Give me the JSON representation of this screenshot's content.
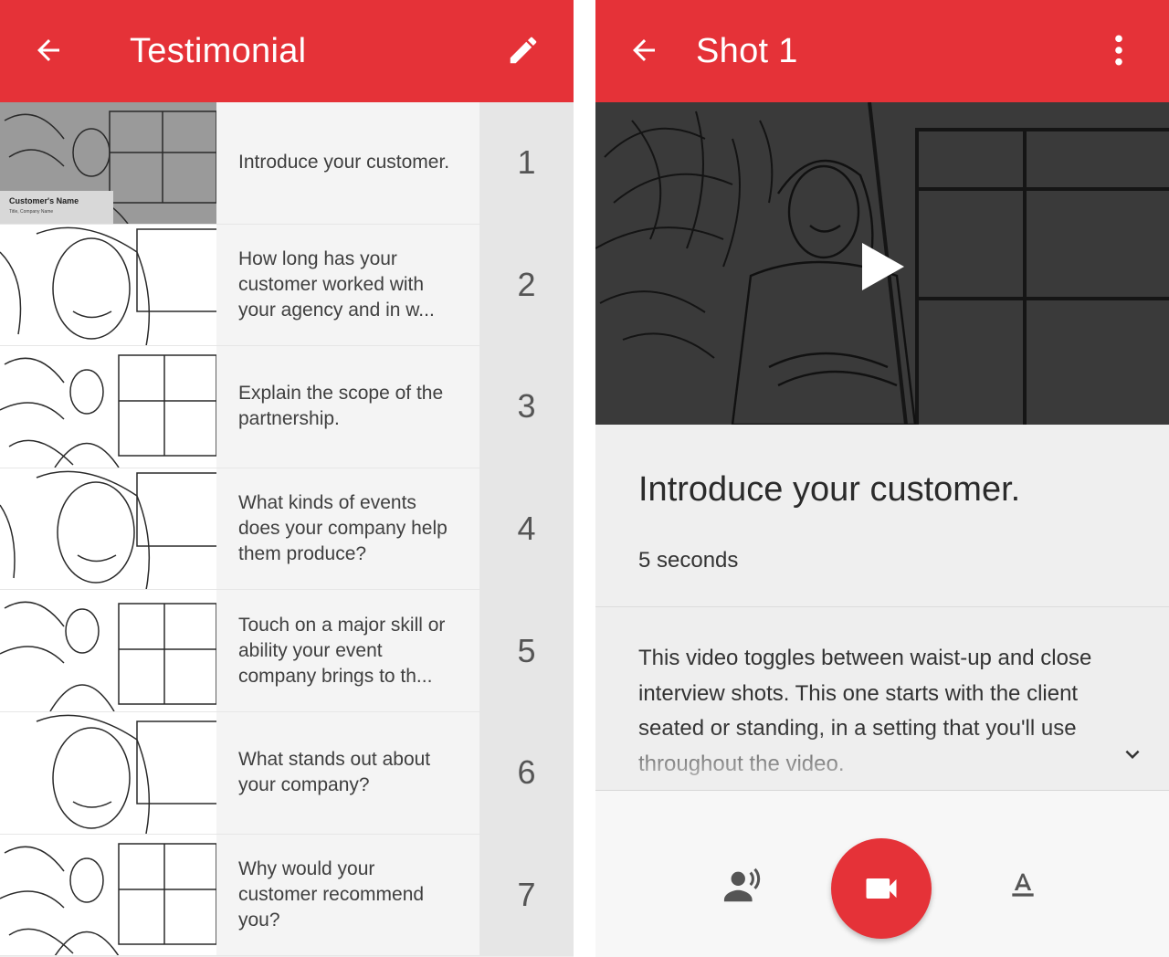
{
  "left": {
    "appbar": {
      "title": "Testimonial",
      "back_icon": "arrow-left-icon",
      "action_icon": "pencil-icon"
    },
    "shots": [
      {
        "number": "1",
        "text": "Introduce your customer.",
        "thumb_caption": "Customer's Name",
        "thumb_subcaption": "Title, Company Name"
      },
      {
        "number": "2",
        "text": "How long has your customer worked with your agency and in w..."
      },
      {
        "number": "3",
        "text": "Explain the scope of the partnership."
      },
      {
        "number": "4",
        "text": "What kinds of events does your company help them produce?"
      },
      {
        "number": "5",
        "text": "Touch on a major skill or ability your event company brings to th..."
      },
      {
        "number": "6",
        "text": "What stands out about your company?"
      },
      {
        "number": "7",
        "text": "Why would your customer recommend you?"
      }
    ]
  },
  "right": {
    "appbar": {
      "title": "Shot 1",
      "back_icon": "arrow-left-icon",
      "menu_icon": "more-vertical-icon"
    },
    "video": {
      "play_icon": "play-icon"
    },
    "shot_title": "Introduce your customer.",
    "duration": "5 seconds",
    "description": "This video toggles between waist-up and close interview shots. This one starts with the client seated or standing, in a setting that you'll use throughout the video.",
    "expand_icon": "chevron-down-icon",
    "bottom_bar": {
      "voiceover_icon": "voiceover-icon",
      "record_icon": "video-camera-icon",
      "text_icon": "text-format-icon"
    }
  },
  "colors": {
    "accent": "#e53238",
    "list_text_bg": "#f4f4f4",
    "list_number_bg": "#e6e6e6",
    "video_bg": "#3a3a3a"
  }
}
